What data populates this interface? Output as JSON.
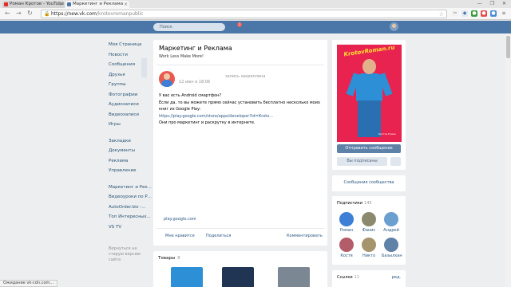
{
  "browser": {
    "tabs": [
      {
        "label": "Роман Кротов - YouTube",
        "favicon_color": "#e52d27"
      },
      {
        "label": "Маркетинг и Реклама",
        "favicon_color": "#4a76a8"
      }
    ],
    "url_host": "https://new.vk.com",
    "url_path": "/krotovromanpublic",
    "status_text": "Ожидание vk-cdn.com...",
    "window_controls": "— ❐ ✕"
  },
  "header": {
    "search_placeholder": "Поиск",
    "notifications_count": "1"
  },
  "left_menu": {
    "primary": [
      "Моя Страница",
      "Новости",
      "Сообщения",
      "Друзья",
      "Группы",
      "Фотографии",
      "Аудиозаписи",
      "Видеозаписи",
      "Игры"
    ],
    "secondary": [
      "Закладки",
      "Документы",
      "Реклама",
      "Управление"
    ],
    "communities": [
      "Маркетинг и Рек...",
      "Видеоуроки по Р...",
      "AutoOrder.biz -...",
      "Топ Интересных...",
      "VS TV"
    ],
    "footer_note": "Вернуться на старую версию сайта"
  },
  "community": {
    "title": "Маркетинг и Реклама",
    "status": "Work Less Make More!"
  },
  "post": {
    "date": "12 июн в 18:06",
    "pinned": "запись закреплена",
    "lines": [
      "У вас есть Android смартфон?",
      "Если да, то вы можете прямо сейчас установить бесплатно несколько моих",
      "книг из Google Play:"
    ],
    "link": "https://play.google.com/store/apps/developer?id=Кroto...",
    "last_line": "Они про маркетинг и раскрутку в интернете.",
    "domain": "play.google.com",
    "like": "Мне нравится",
    "share": "Поделиться",
    "comment": "Комментировать"
  },
  "goods": {
    "title": "Товары",
    "count": "8",
    "colors": [
      "#2d8fd6",
      "#1f3553",
      "#7b8793"
    ]
  },
  "profile": {
    "photo_brand": "KrotovRoman.ru",
    "photo_caption": "Кротов Роман",
    "send_message": "Отправить сообщение",
    "subscribed": "Вы подписаны",
    "community_messages": "Сообщения сообщества"
  },
  "subscribers": {
    "title": "Подписчики",
    "count": "145",
    "people": [
      {
        "name": "Роман",
        "color": "#3d7fd6"
      },
      {
        "name": "Фанис",
        "color": "#8c8a6e"
      },
      {
        "name": "Андрей",
        "color": "#6a9fd0"
      },
      {
        "name": "Костя",
        "color": "#b45d6a"
      },
      {
        "name": "Никто",
        "color": "#a5956c"
      },
      {
        "name": "Базылхан",
        "color": "#5f82a6"
      }
    ]
  },
  "links": {
    "title": "Ссылки",
    "count": "11",
    "edit": "ред."
  }
}
